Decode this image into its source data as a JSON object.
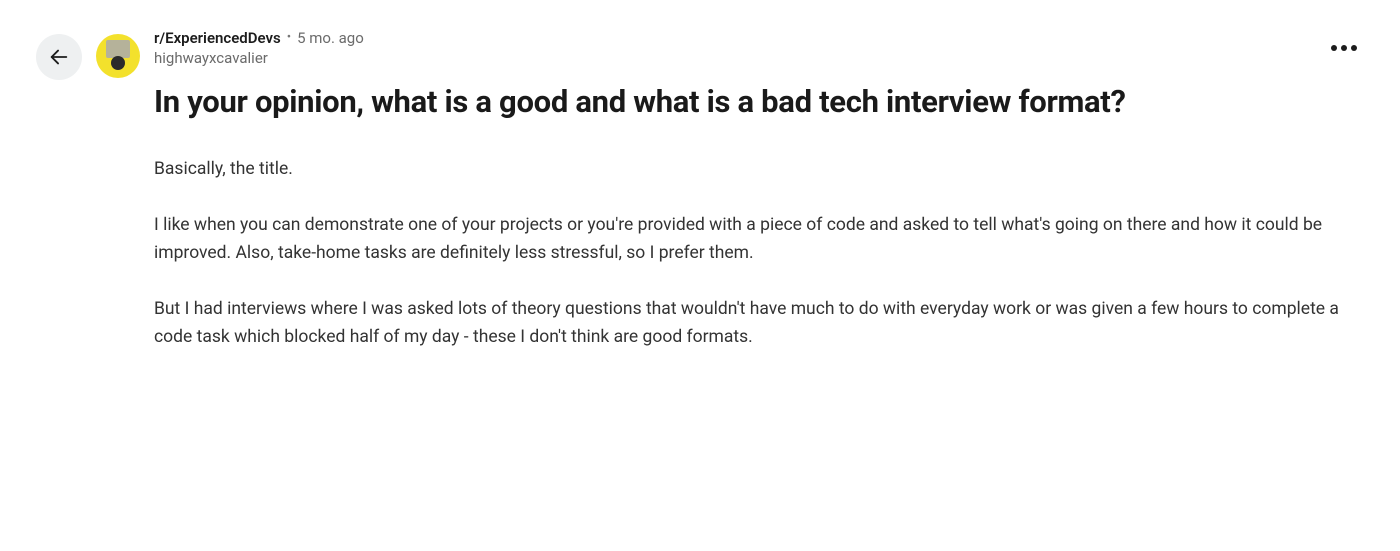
{
  "post": {
    "subreddit": "r/ExperiencedDevs",
    "time_ago": "5 mo. ago",
    "username": "highwayxcavalier",
    "title": "In your opinion, what is a good and what is a bad tech interview format?",
    "body_paragraphs": [
      "Basically, the title.",
      "I like when you can demonstrate one of your projects or you're provided with a piece of code and asked to tell what's going on there and how it could be improved. Also, take-home tasks are definitely less stressful, so I prefer them.",
      "But I had interviews where I was asked lots of theory questions that wouldn't have much to do with everyday work or was given a few hours to complete a code task which blocked half of my day - these I don't think are good formats."
    ]
  }
}
